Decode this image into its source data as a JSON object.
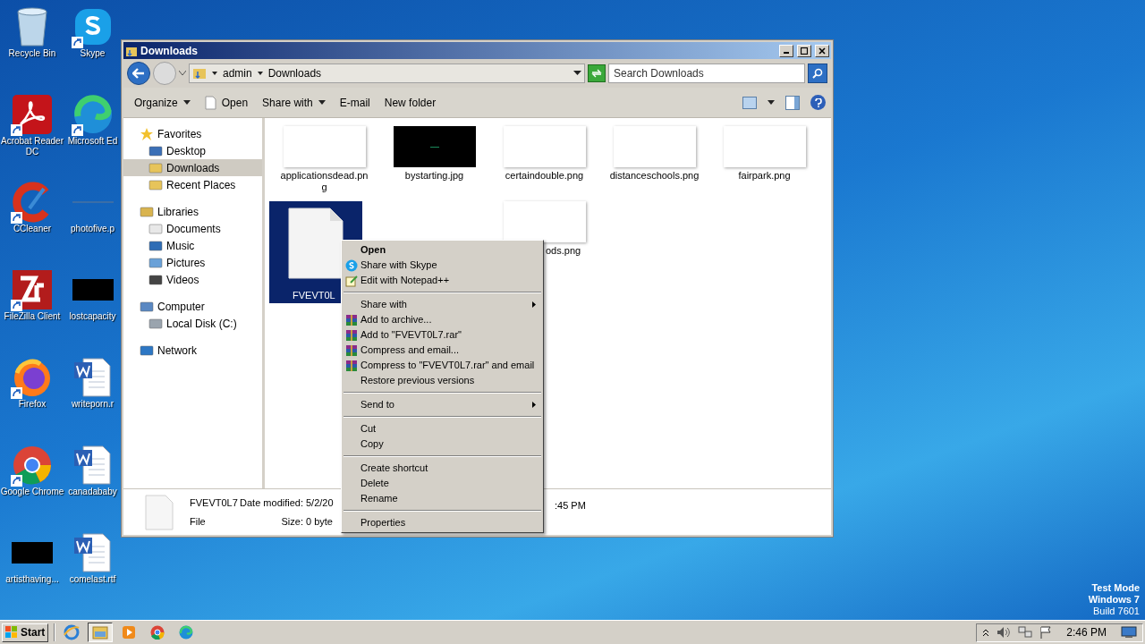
{
  "desktop_icons": [
    {
      "label": "Recycle Bin",
      "kind": "bin",
      "shortcut": false
    },
    {
      "label": "Skype",
      "kind": "skype",
      "shortcut": true
    },
    {
      "label": "Acrobat Reader DC",
      "kind": "acrobat",
      "shortcut": true
    },
    {
      "label": "Microsoft Ed",
      "kind": "edge",
      "shortcut": true
    },
    {
      "label": "CCleaner",
      "kind": "ccleaner",
      "shortcut": true
    },
    {
      "label": "photofive.p",
      "kind": "blank",
      "shortcut": false
    },
    {
      "label": "FileZilla Client",
      "kind": "filezilla",
      "shortcut": true
    },
    {
      "label": "lostcapacity",
      "kind": "dark",
      "shortcut": false
    },
    {
      "label": "Firefox",
      "kind": "firefox",
      "shortcut": true
    },
    {
      "label": "writeporn.r",
      "kind": "word",
      "shortcut": false
    },
    {
      "label": "Google Chrome",
      "kind": "chrome",
      "shortcut": true
    },
    {
      "label": "canadababy",
      "kind": "word",
      "shortcut": false
    },
    {
      "label": "artisthaving...",
      "kind": "dark",
      "shortcut": false
    },
    {
      "label": "comelast.rtf",
      "kind": "word",
      "shortcut": false
    }
  ],
  "window": {
    "title": "Downloads",
    "breadcrumb": [
      "admin",
      "Downloads"
    ],
    "search": {
      "placeholder": "Search Downloads"
    },
    "toolbar": [
      {
        "label": "Organize",
        "kind": "menu"
      },
      {
        "label": "Open",
        "kind": "open"
      },
      {
        "label": "Share with",
        "kind": "menu"
      },
      {
        "label": "E-mail",
        "kind": "plain"
      },
      {
        "label": "New folder",
        "kind": "plain"
      }
    ],
    "nav": [
      {
        "label": "Favorites",
        "kind": "star",
        "selected": false,
        "children": [
          {
            "label": "Desktop",
            "kind": "desktop",
            "selected": false
          },
          {
            "label": "Downloads",
            "kind": "downloads",
            "selected": true
          },
          {
            "label": "Recent Places",
            "kind": "recent",
            "selected": false
          }
        ]
      },
      {
        "label": "Libraries",
        "kind": "library",
        "selected": false,
        "children": [
          {
            "label": "Documents",
            "kind": "documents",
            "selected": false
          },
          {
            "label": "Music",
            "kind": "music",
            "selected": false
          },
          {
            "label": "Pictures",
            "kind": "pictures",
            "selected": false
          },
          {
            "label": "Videos",
            "kind": "videos",
            "selected": false
          }
        ]
      },
      {
        "label": "Computer",
        "kind": "computer",
        "selected": false,
        "children": [
          {
            "label": "Local Disk (C:)",
            "kind": "disk",
            "selected": false
          }
        ]
      },
      {
        "label": "Network",
        "kind": "network",
        "selected": false
      }
    ],
    "files": [
      {
        "name": "applicationsdead.png",
        "kind": "white",
        "selected": false
      },
      {
        "name": "bystarting.jpg",
        "kind": "black",
        "selected": false
      },
      {
        "name": "certaindouble.png",
        "kind": "white",
        "selected": false
      },
      {
        "name": "distanceschools.png",
        "kind": "white",
        "selected": false
      },
      {
        "name": "fairpark.png",
        "kind": "white",
        "selected": false
      },
      {
        "name": "FVEVT0L",
        "kind": "document",
        "selected": true
      },
      {
        "name": "ods.png",
        "kind": "white",
        "selected": false
      }
    ],
    "details": {
      "name": "FVEVT0L7",
      "type": "File",
      "date_label": "Date modified:",
      "date": "5/2/20",
      "time": ":45 PM",
      "size_label": "Size:",
      "size": "0 byte"
    }
  },
  "context_menu": [
    {
      "kind": "plain",
      "label": "Open",
      "bold": true,
      "submenu": false
    },
    {
      "kind": "skype",
      "label": "Share with Skype",
      "bold": false,
      "submenu": false
    },
    {
      "kind": "notepad",
      "label": "Edit with Notepad++",
      "bold": false,
      "submenu": false
    },
    {
      "kind": "separator"
    },
    {
      "kind": "plain",
      "label": "Share with",
      "bold": false,
      "submenu": true
    },
    {
      "kind": "archive",
      "label": "Add to archive...",
      "bold": false,
      "submenu": false
    },
    {
      "kind": "archive",
      "label": "Add to \"FVEVT0L7.rar\"",
      "bold": false,
      "submenu": false
    },
    {
      "kind": "archive",
      "label": "Compress and email...",
      "bold": false,
      "submenu": false
    },
    {
      "kind": "archive",
      "label": "Compress to \"FVEVT0L7.rar\" and email",
      "bold": false,
      "submenu": false
    },
    {
      "kind": "plain",
      "label": "Restore previous versions",
      "bold": false,
      "submenu": false
    },
    {
      "kind": "separator"
    },
    {
      "kind": "plain",
      "label": "Send to",
      "bold": false,
      "submenu": true
    },
    {
      "kind": "separator"
    },
    {
      "kind": "plain",
      "label": "Cut",
      "bold": false,
      "submenu": false
    },
    {
      "kind": "plain",
      "label": "Copy",
      "bold": false,
      "submenu": false
    },
    {
      "kind": "separator"
    },
    {
      "kind": "plain",
      "label": "Create shortcut",
      "bold": false,
      "submenu": false
    },
    {
      "kind": "plain",
      "label": "Delete",
      "bold": false,
      "submenu": false
    },
    {
      "kind": "plain",
      "label": "Rename",
      "bold": false,
      "submenu": false
    },
    {
      "kind": "separator"
    },
    {
      "kind": "plain",
      "label": "Properties",
      "bold": false,
      "submenu": false
    }
  ],
  "system_notice": [
    "Test Mode",
    "Windows 7",
    "Build 7601"
  ],
  "taskbar": {
    "start": "Start",
    "apps": [
      {
        "kind": "ie",
        "selected": false
      },
      {
        "kind": "explorer",
        "selected": true
      },
      {
        "kind": "media",
        "selected": false
      },
      {
        "kind": "chrome",
        "selected": false
      },
      {
        "kind": "edge",
        "selected": false
      }
    ],
    "clock": "2:46 PM"
  }
}
